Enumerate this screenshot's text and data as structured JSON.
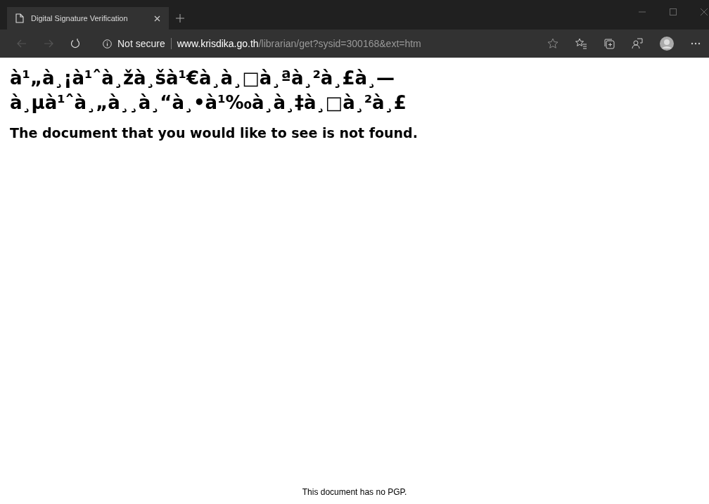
{
  "browser": {
    "tab": {
      "title": "Digital Signature Verification",
      "selected": true
    },
    "security": "Not secure",
    "url_host": "www.krisdika.go.th",
    "url_path": "/librarian/get?sysid=300168&ext=htm"
  },
  "page": {
    "heading_lines": [
      "à¹„à¸¡à¹ˆà¸žà¸šà¹€à¸à¸□à¸ªà¸²à¸£à¸—",
      "à¸µà¹ˆà¸„à¸¸à¸“à¸•à¹‰à¸à¸‡à¸□à¸²à¸£"
    ],
    "message": "The document that you would like to see is not found.",
    "footer": "This document has no PGP."
  }
}
